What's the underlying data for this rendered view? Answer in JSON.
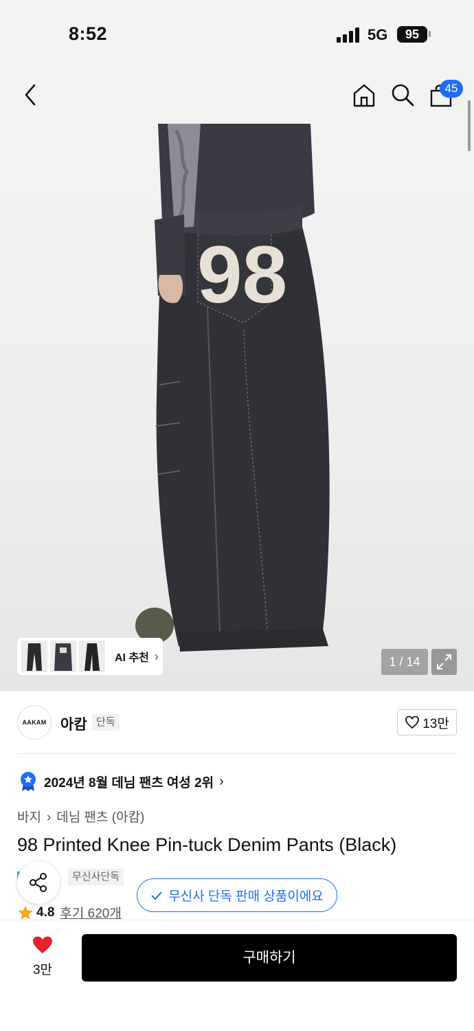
{
  "status_bar": {
    "time": "8:52",
    "network": "5G",
    "battery": "95"
  },
  "nav": {
    "cart_count": "45"
  },
  "gallery": {
    "counter": "1 / 14",
    "ai_label": "AI 추천",
    "ai_chevron": "›",
    "print_number": "98"
  },
  "brand": {
    "logo_text": "AAKAM",
    "name": "아캄",
    "tag": "단독",
    "likes": "13만"
  },
  "ranking": {
    "text": "2024년 8월 데님 팬츠 여성 2위",
    "chevron": "›"
  },
  "breadcrumb": {
    "category": "바지",
    "separator": "›",
    "subcategory": "데님 팬츠 (아캄)"
  },
  "product": {
    "title": "98 Printed Knee Pin-tuck Denim Pants (Black)"
  },
  "exclusive": {
    "badge": "무신사단독",
    "tooltip": "무신사 단독 판매 상품이에요"
  },
  "rating": {
    "score": "4.8",
    "reviews": "후기 620개"
  },
  "bottom_bar": {
    "wish_count": "3만",
    "buy_label": "구매하기"
  },
  "colors": {
    "accent": "#1e6ef5",
    "heart": "#e8202e",
    "buy_bg": "#000000"
  }
}
